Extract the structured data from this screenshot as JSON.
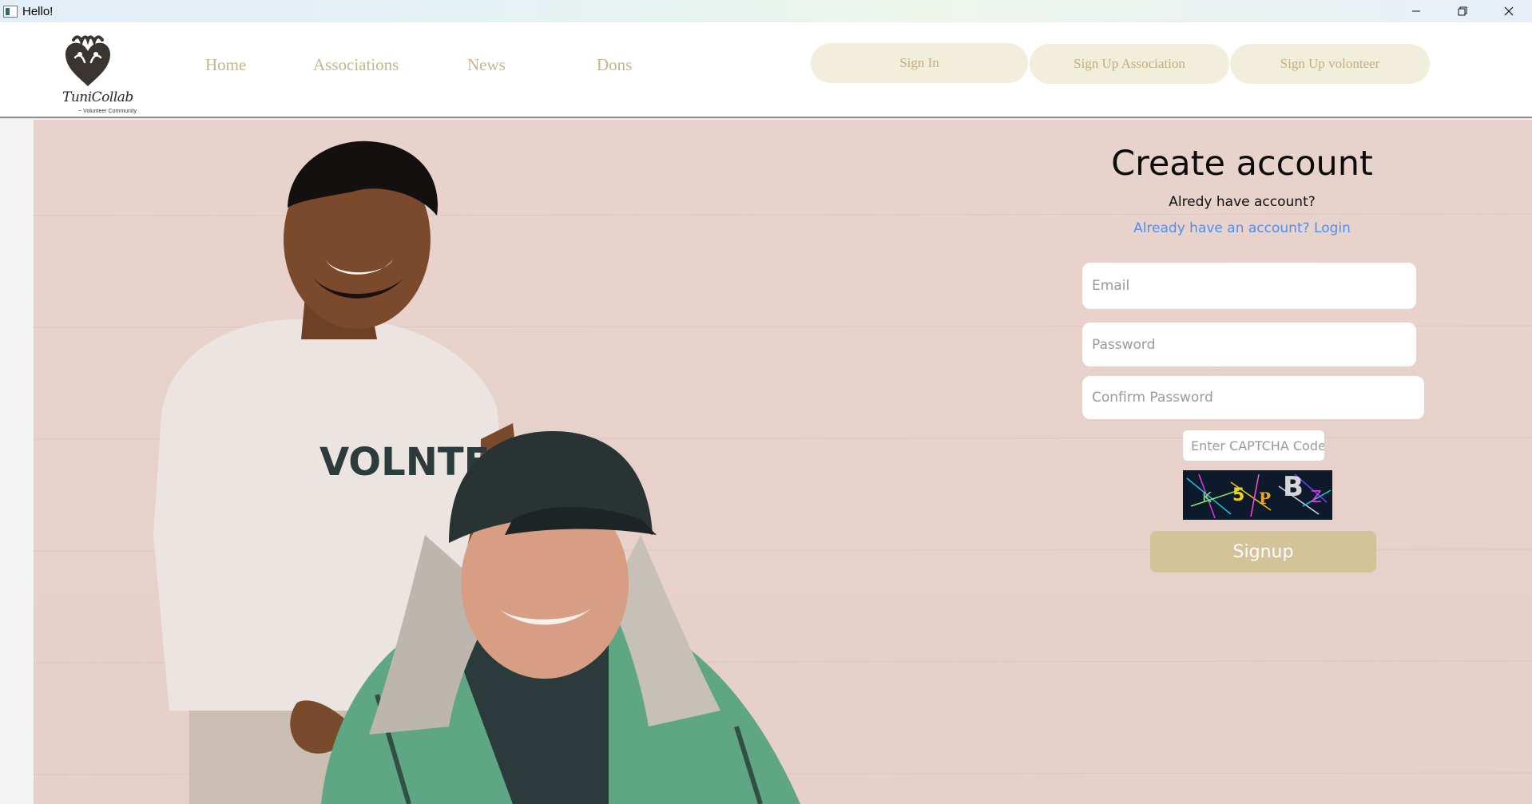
{
  "window": {
    "title": "Hello!",
    "controls": [
      "minimize",
      "restore",
      "close"
    ]
  },
  "brand": {
    "name": "TuniCollab",
    "tagline": "~ Volunteer Community"
  },
  "nav": {
    "links": [
      "Home",
      "Associations",
      "News",
      "Dons"
    ],
    "buttons": [
      "Sign In",
      "Sign Up Association",
      "Sign Up volonteer"
    ]
  },
  "form": {
    "title": "Create account",
    "subtitle": "Alredy have account?",
    "login_link": "Already have an account? Login",
    "email_placeholder": "Email",
    "password_placeholder": "Password",
    "confirm_placeholder": "Confirm Password",
    "captcha_placeholder": "Enter CAPTCHA Code",
    "captcha_text": "K5PBZ",
    "submit_label": "Signup"
  },
  "hero": {
    "shirt_text": "VOLNTEER"
  },
  "colors": {
    "accent": "#d4c398",
    "nav_text": "#c9b389",
    "pill_bg": "#f1eedb",
    "link": "#4e8ff0",
    "hero_bg": "#e8d2cc"
  }
}
